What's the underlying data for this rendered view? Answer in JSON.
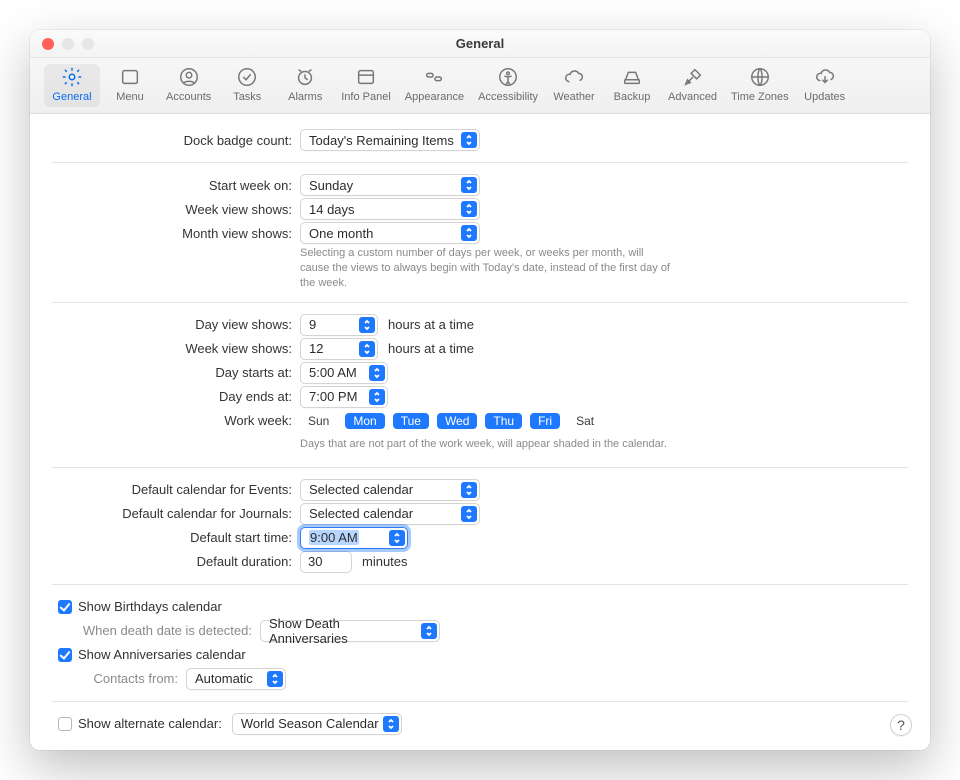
{
  "window": {
    "title": "General"
  },
  "toolbar": {
    "items": [
      {
        "label": "General"
      },
      {
        "label": "Menu"
      },
      {
        "label": "Accounts"
      },
      {
        "label": "Tasks"
      },
      {
        "label": "Alarms"
      },
      {
        "label": "Info Panel"
      },
      {
        "label": "Appearance"
      },
      {
        "label": "Accessibility"
      },
      {
        "label": "Weather"
      },
      {
        "label": "Backup"
      },
      {
        "label": "Advanced"
      },
      {
        "label": "Time Zones"
      },
      {
        "label": "Updates"
      }
    ]
  },
  "section1": {
    "dock_badge_label": "Dock badge count:",
    "dock_badge_value": "Today's Remaining Items"
  },
  "section2": {
    "start_week_label": "Start week on:",
    "start_week_value": "Sunday",
    "week_view_label": "Week view shows:",
    "week_view_value": "14 days",
    "month_view_label": "Month view shows:",
    "month_view_value": "One month",
    "help": "Selecting a custom number of days per week, or weeks per month, will cause the views to always begin with Today's date, instead of the first day of the week."
  },
  "section3": {
    "day_view_label": "Day view shows:",
    "day_view_value": "9",
    "hours_suffix": "hours at a time",
    "week_view_label": "Week view shows:",
    "week_view_value": "12",
    "day_starts_label": "Day starts at:",
    "day_starts_value": "5:00 AM",
    "day_ends_label": "Day ends at:",
    "day_ends_value": "7:00 PM",
    "work_week_label": "Work week:",
    "days": {
      "sun": "Sun",
      "mon": "Mon",
      "tue": "Tue",
      "wed": "Wed",
      "thu": "Thu",
      "fri": "Fri",
      "sat": "Sat"
    },
    "work_week_help": "Days that are not part of the work week, will appear shaded in the calendar."
  },
  "section4": {
    "def_cal_events_label": "Default calendar for Events:",
    "def_cal_events_value": "Selected calendar",
    "def_cal_journals_label": "Default calendar for Journals:",
    "def_cal_journals_value": "Selected calendar",
    "def_start_time_label": "Default start time:",
    "def_start_time_value": "9:00 AM",
    "def_duration_label": "Default duration:",
    "def_duration_value": "30",
    "minutes_suffix": "minutes"
  },
  "section5": {
    "show_birthdays_label": "Show Birthdays calendar",
    "death_label": "When death date is detected:",
    "death_value": "Show Death Anniversaries",
    "show_anniv_label": "Show Anniversaries calendar",
    "contacts_from_label": "Contacts from:",
    "contacts_from_value": "Automatic"
  },
  "section6": {
    "alt_cal_label": "Show alternate calendar:",
    "alt_cal_value": "World Season Calendar"
  },
  "help_button": "?"
}
